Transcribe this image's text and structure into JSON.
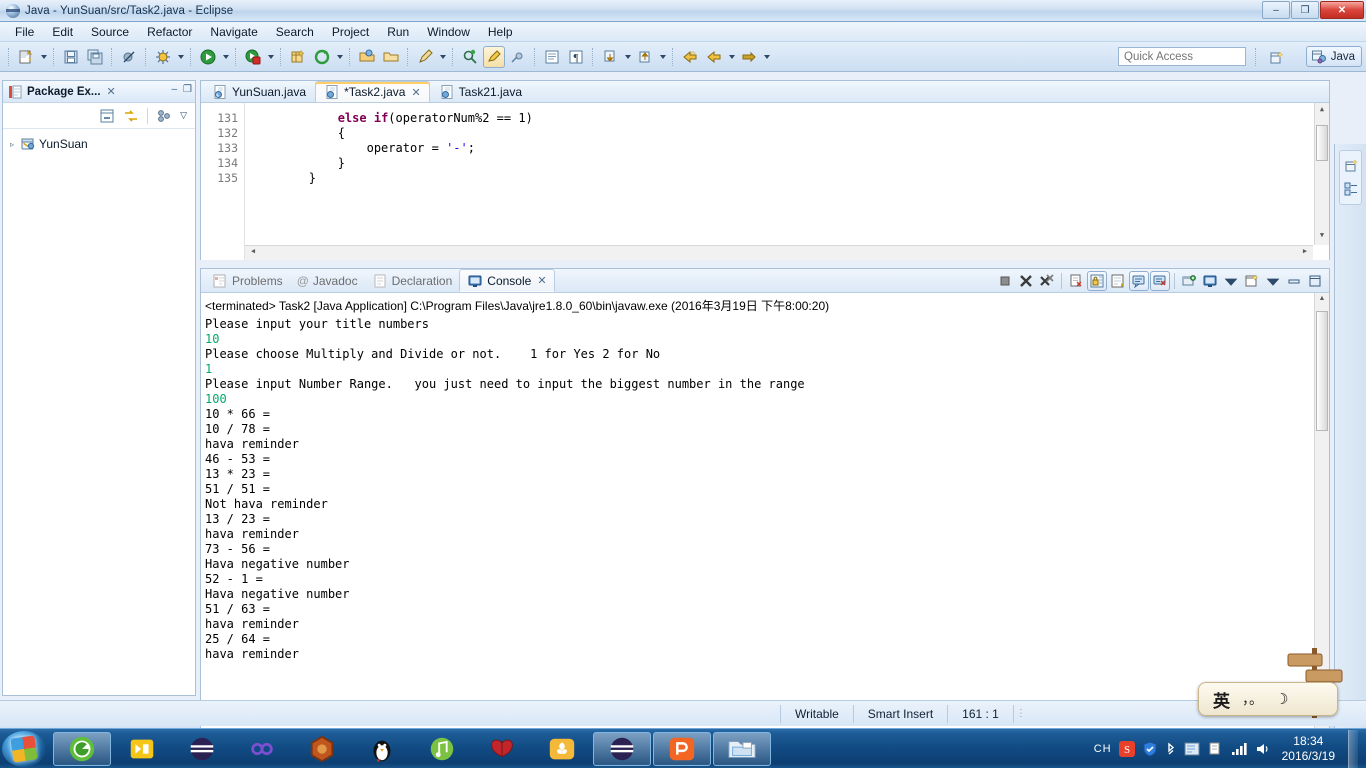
{
  "window": {
    "title": "Java - YunSuan/src/Task2.java - Eclipse",
    "icon": "eclipse-icon",
    "minimize_label": "–",
    "maximize_label": "❐",
    "close_label": "✕"
  },
  "menubar": {
    "items": [
      {
        "label": "File",
        "name": "menu-file"
      },
      {
        "label": "Edit",
        "name": "menu-edit"
      },
      {
        "label": "Source",
        "name": "menu-source"
      },
      {
        "label": "Refactor",
        "name": "menu-refactor"
      },
      {
        "label": "Navigate",
        "name": "menu-navigate"
      },
      {
        "label": "Search",
        "name": "menu-search"
      },
      {
        "label": "Project",
        "name": "menu-project"
      },
      {
        "label": "Run",
        "name": "menu-run"
      },
      {
        "label": "Window",
        "name": "menu-window"
      },
      {
        "label": "Help",
        "name": "menu-help"
      }
    ]
  },
  "toolbar": {
    "quick_access_placeholder": "Quick Access",
    "perspective_label": "Java",
    "open_perspective_tooltip": "Open Perspective",
    "buttons": [
      "new-wizard-icon",
      "save-icon",
      "save-all-icon",
      "skip-breakpoints-icon",
      "debug-icon",
      "run-icon",
      "run-coverage-icon",
      "new-java-package-icon",
      "external-tools-icon",
      "open-type-icon",
      "open-task-icon",
      "search-icon",
      "next-annotation-icon",
      "previous-annotation-icon",
      "last-edit-icon",
      "back-icon",
      "forward-icon"
    ]
  },
  "package_explorer": {
    "title": "Package Ex...",
    "close_label": "✕",
    "minimize_label": "–",
    "maximize_label": "❐",
    "view_menu_label": "▽",
    "tree": [
      {
        "label": "YunSuan",
        "expander": "▹",
        "icon": "java-project-icon"
      }
    ]
  },
  "editor": {
    "tabs": [
      {
        "label": "YunSuan.java",
        "selected": false,
        "dirty": false,
        "closable": false
      },
      {
        "label": "*Task2.java",
        "selected": true,
        "dirty": true,
        "closable": true
      },
      {
        "label": "Task21.java",
        "selected": false,
        "dirty": false,
        "closable": false
      }
    ],
    "close_label": "✕",
    "lines": [
      {
        "num": "131",
        "indent": 12,
        "parts": [
          {
            "t": "else",
            "c": "kw"
          },
          {
            "t": " ",
            "c": ""
          },
          {
            "t": "if",
            "c": "kw"
          },
          {
            "t": "(operatorNum%2 == 1)",
            "c": ""
          }
        ]
      },
      {
        "num": "132",
        "indent": 12,
        "parts": [
          {
            "t": "{",
            "c": ""
          }
        ]
      },
      {
        "num": "133",
        "indent": 16,
        "parts": [
          {
            "t": "operator = ",
            "c": ""
          },
          {
            "t": "'-'",
            "c": "str"
          },
          {
            "t": ";",
            "c": ""
          }
        ]
      },
      {
        "num": "134",
        "indent": 12,
        "parts": [
          {
            "t": "}",
            "c": ""
          }
        ]
      },
      {
        "num": "135",
        "indent": 8,
        "parts": [
          {
            "t": "}",
            "c": ""
          }
        ]
      }
    ]
  },
  "console_view": {
    "tabs": [
      {
        "label": "Problems",
        "icon": "problems-icon",
        "selected": false
      },
      {
        "label": "Javadoc",
        "icon": "javadoc-icon",
        "selected": false
      },
      {
        "label": "Declaration",
        "icon": "declaration-icon",
        "selected": false
      },
      {
        "label": "Console",
        "icon": "console-icon",
        "selected": true
      }
    ],
    "close_label": "✕",
    "tools": [
      "terminate-icon",
      "remove-launch-icon",
      "remove-all-terminated-icon",
      "clear-console-icon",
      "scroll-lock-icon",
      "word-wrap-icon",
      "show-console-on-output-icon",
      "pin-console-icon",
      "display-selected-console-icon",
      "open-console-icon",
      "minimize-icon",
      "maximize-icon"
    ],
    "terminated_line": "<terminated> Task2 [Java Application] C:\\Program Files\\Java\\jre1.8.0_60\\bin\\javaw.exe (2016年3月19日 下午8:00:20)",
    "output": [
      {
        "text": "Please input your title numbers",
        "kind": "out"
      },
      {
        "text": "10",
        "kind": "in"
      },
      {
        "text": "Please choose Multiply and Divide or not.    1 for Yes 2 for No",
        "kind": "out"
      },
      {
        "text": "1",
        "kind": "in"
      },
      {
        "text": "Please input Number Range.   you just need to input the biggest number in the range",
        "kind": "out"
      },
      {
        "text": "100",
        "kind": "in"
      },
      {
        "text": "10 * 66 =",
        "kind": "out"
      },
      {
        "text": "10 / 78 =",
        "kind": "out"
      },
      {
        "text": "hava reminder",
        "kind": "out"
      },
      {
        "text": "46 - 53 =",
        "kind": "out"
      },
      {
        "text": "13 * 23 =",
        "kind": "out"
      },
      {
        "text": "51 / 51 =",
        "kind": "out"
      },
      {
        "text": "Not hava reminder",
        "kind": "out"
      },
      {
        "text": "13 / 23 =",
        "kind": "out"
      },
      {
        "text": "hava reminder",
        "kind": "out"
      },
      {
        "text": "73 - 56 =",
        "kind": "out"
      },
      {
        "text": "Hava negative number",
        "kind": "out"
      },
      {
        "text": "52 - 1 =",
        "kind": "out"
      },
      {
        "text": "Hava negative number",
        "kind": "out"
      },
      {
        "text": "51 / 63 =",
        "kind": "out"
      },
      {
        "text": "hava reminder",
        "kind": "out"
      },
      {
        "text": "25 / 64 =",
        "kind": "out"
      },
      {
        "text": "hava reminder",
        "kind": "out"
      }
    ]
  },
  "statusbar": {
    "writable": "Writable",
    "insert_mode": "Smart Insert",
    "position": "161 : 1"
  },
  "taskbar": {
    "start_tooltip": "Start",
    "items": [
      {
        "name": "taskbar-item-eclipse",
        "running": true,
        "icon": "eclipse-icon"
      },
      {
        "name": "taskbar-item-kugou",
        "running": false,
        "icon": "kugou-icon"
      },
      {
        "name": "taskbar-item-browser",
        "running": false,
        "icon": "browser-icon"
      },
      {
        "name": "taskbar-item-tool",
        "running": false,
        "icon": "infinity-icon"
      },
      {
        "name": "taskbar-item-game",
        "running": false,
        "icon": "hexagon-icon"
      },
      {
        "name": "taskbar-item-qq",
        "running": false,
        "icon": "penguin-icon"
      },
      {
        "name": "taskbar-item-music",
        "running": false,
        "icon": "music-icon"
      },
      {
        "name": "taskbar-item-butterfly",
        "running": false,
        "icon": "butterfly-icon"
      },
      {
        "name": "taskbar-item-notes",
        "running": false,
        "icon": "leaf-icon"
      },
      {
        "name": "taskbar-item-browser2",
        "running": true,
        "icon": "browser-icon"
      },
      {
        "name": "taskbar-item-wps",
        "running": true,
        "icon": "wps-icon"
      },
      {
        "name": "taskbar-item-explorer",
        "running": true,
        "icon": "folder-icon"
      }
    ],
    "tray": {
      "input_indicator": "CH",
      "icons": [
        "sogou-icon",
        "shield-icon",
        "bluetooth-icon",
        "screenshot-icon",
        "usb-icon",
        "network-icon",
        "volume-icon"
      ],
      "time": "18:34",
      "date": "2016/3/19"
    }
  },
  "ime_bar": {
    "mode": "英",
    "punctuation": "，。",
    "moon": "☽"
  }
}
